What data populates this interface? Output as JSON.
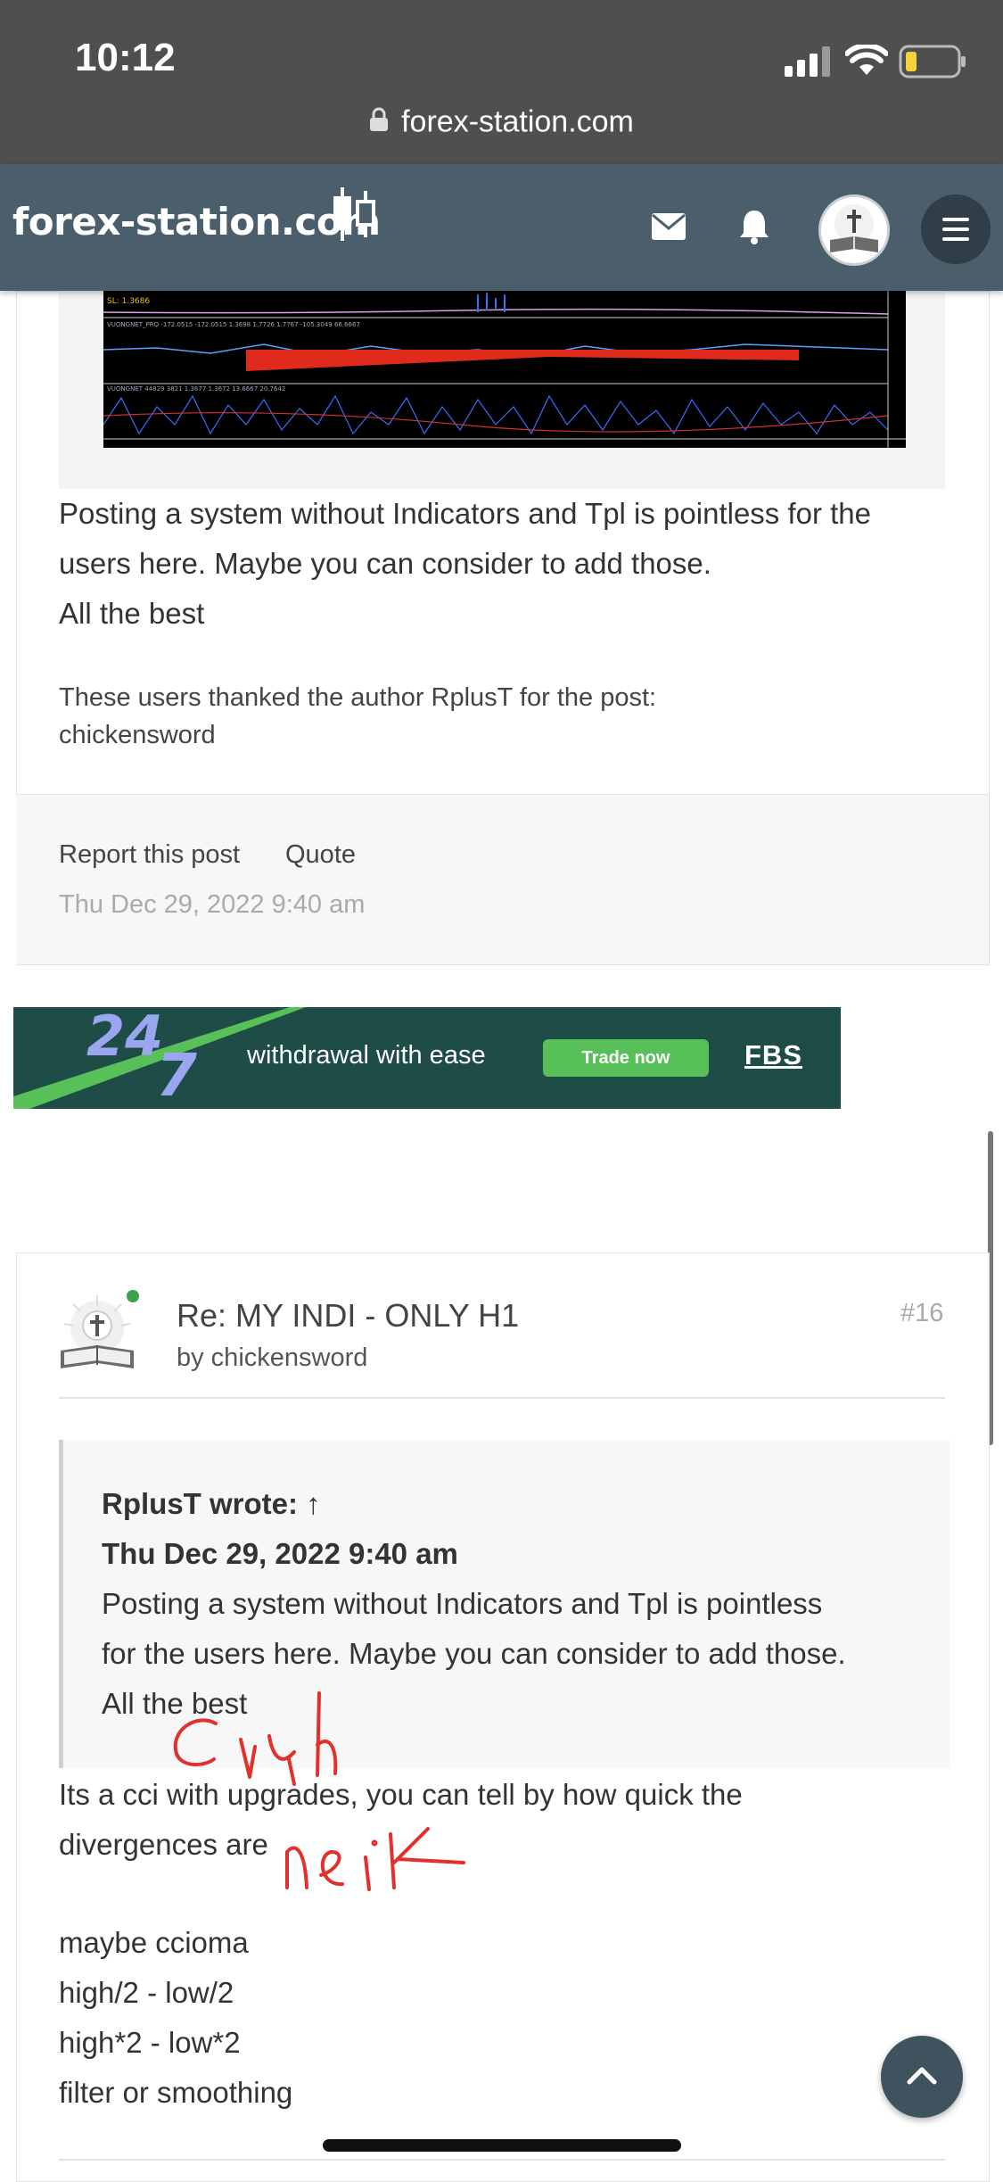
{
  "status_bar": {
    "time": "10:12"
  },
  "browser": {
    "url": "forex-station.com"
  },
  "header": {
    "logo_text": "forex-station.com"
  },
  "post1": {
    "body_lines": [
      "Posting a system without Indicators and Tpl is pointless for the",
      "users here. Maybe you can consider to add those.",
      "All the best"
    ],
    "thanks_label": "These users thanked the author RplusT for the post:",
    "thanks_user": "chickensword",
    "report_label": "Report this post",
    "quote_label": "Quote",
    "date": "Thu Dec 29, 2022 9:40 am"
  },
  "banner": {
    "big_number_top": "24",
    "big_number_bottom": "7",
    "tagline": "withdrawal with ease",
    "button_label": "Trade now",
    "brand": "FBS"
  },
  "post2": {
    "title": "Re: MY INDI - ONLY H1",
    "author_line": "by chickensword",
    "post_number": "#16",
    "quote_author": "RplusT wrote: ↑",
    "quote_date": "Thu Dec 29, 2022 9:40 am",
    "quote_lines": [
      "Posting a system without Indicators and Tpl is pointless",
      "for the users here. Maybe you can consider to add those.",
      "All the best"
    ],
    "reply_lines": [
      "Its a cci with upgrades, you can tell by how quick the",
      "divergences are"
    ],
    "list_items": [
      "maybe ccioma",
      "high/2 - low/2",
      "high*2 - low*2",
      "filter or smoothing"
    ]
  },
  "colors": {
    "header_bg": "#4a5f6b",
    "banner_bg": "#1e4c47",
    "banner_button": "#58c058",
    "banner_number": "#9aa6f0",
    "scribble": "#e0312c"
  },
  "icons": [
    "lock-icon",
    "signal-icon",
    "wifi-icon",
    "battery-icon",
    "logo-candles-icon",
    "envelope-icon",
    "bell-icon",
    "avatar",
    "hamburger-icon",
    "chevron-up-icon"
  ]
}
